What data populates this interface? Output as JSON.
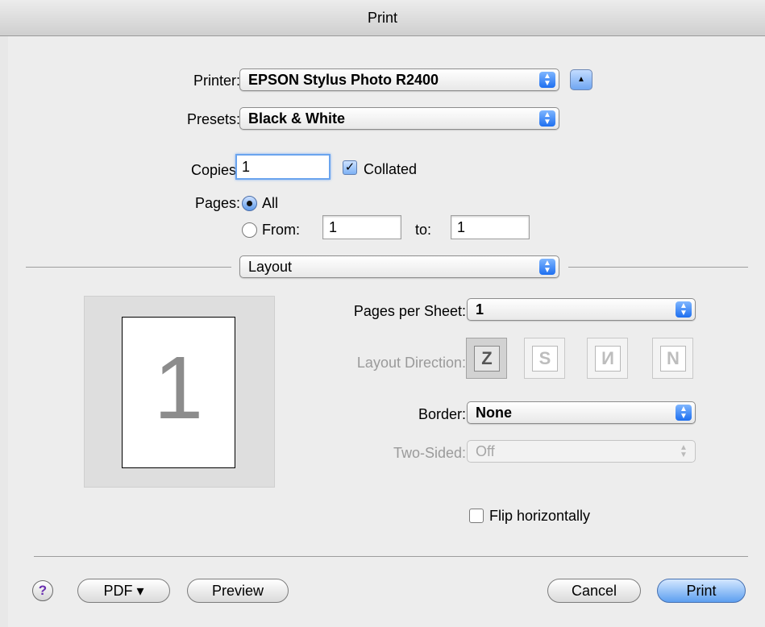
{
  "window": {
    "title": "Print"
  },
  "printer": {
    "label": "Printer:",
    "value": "EPSON Stylus Photo R2400",
    "disclose_icon": "triangle-up-icon"
  },
  "presets": {
    "label": "Presets:",
    "value": "Black & White"
  },
  "copies": {
    "label": "Copies:",
    "value": "1",
    "collated_label": "Collated",
    "collated_checked": true
  },
  "pages": {
    "label": "Pages:",
    "all_label": "All",
    "all_selected": true,
    "from_label": "From:",
    "from_value": "1",
    "to_label": "to:",
    "to_value": "1"
  },
  "section_popup": {
    "value": "Layout"
  },
  "preview": {
    "page_number": "1"
  },
  "layout": {
    "pages_per_sheet_label": "Pages per Sheet:",
    "pages_per_sheet_value": "1",
    "layout_direction_label": "Layout Direction:",
    "directions": [
      {
        "name": "z-left-right-icon",
        "glyph": "Z"
      },
      {
        "name": "z-right-left-icon",
        "glyph": "S"
      },
      {
        "name": "n-top-bottom-icon",
        "glyph": "И"
      },
      {
        "name": "n-reverse-icon",
        "glyph": "N"
      }
    ],
    "border_label": "Border:",
    "border_value": "None",
    "two_sided_label": "Two-Sided:",
    "two_sided_value": "Off",
    "flip_label": "Flip horizontally",
    "flip_checked": false
  },
  "footer": {
    "help": "?",
    "pdf": "PDF ▾",
    "preview": "Preview",
    "cancel": "Cancel",
    "print": "Print"
  },
  "colors": {
    "accent": "#5d9ff0",
    "disabled_text": "#9a9a9a"
  }
}
